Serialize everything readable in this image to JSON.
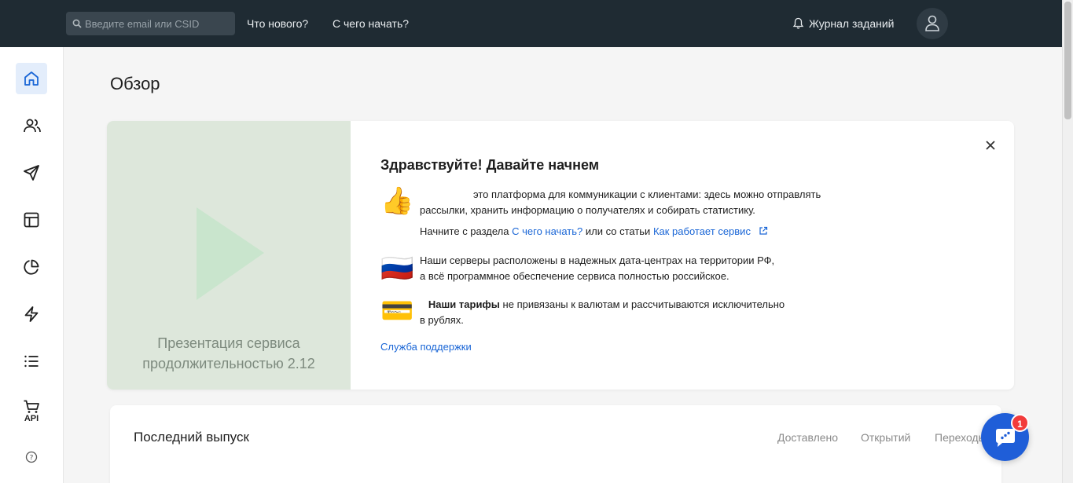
{
  "topbar": {
    "search_placeholder": "Введите email или CSID",
    "links": [
      "Что нового?",
      "С чего начать?"
    ],
    "journal_label": "Журнал заданий",
    "icons": {
      "search": "search-icon",
      "bell": "bell-icon",
      "avatar": "user-icon"
    }
  },
  "sidebar": {
    "items": [
      {
        "icon": "home-icon",
        "active": true
      },
      {
        "icon": "users-icon"
      },
      {
        "icon": "send-icon"
      },
      {
        "icon": "layout-icon"
      },
      {
        "icon": "pie-chart-icon"
      },
      {
        "icon": "zap-icon"
      },
      {
        "icon": "list-icon"
      }
    ],
    "api_label": "API",
    "help_label": "?"
  },
  "main": {
    "page_title": "Обзор",
    "welcome": {
      "video_caption_1": "Презентация сервиса",
      "video_caption_2": "продолжительностью 2.12",
      "title": "Здравствуйте! Давайте начнем",
      "p1_line1": "это платформа для коммуникации с клиентами: здесь можно отправлять",
      "p1_line2": "рассылки, хранить информацию о получателях и собирать статистику.",
      "p2_prefix": "Начните с раздела",
      "p2_link1": "С чего начать?",
      "p2_middle": "или со статьи",
      "p2_link2": "Как работает",
      "p2_link2_suffix": "сервис",
      "p3_line1": "Наши серверы расположены в надежных дата-центрах на территории РФ,",
      "p3_line2": "а всё программное обеспечение сервиса полностью российское.",
      "p4_bold": "Наши тарифы",
      "p4_line1_rest": "не привязаны к валютам и рассчитываются исключительно",
      "p4_line2": "в рублях.",
      "support_link": "Служба поддержки",
      "emojis": {
        "thumb": "👍",
        "flag": "🇷🇺",
        "card": "💳"
      }
    },
    "last_issue": {
      "title": "Последний выпуск",
      "columns": [
        "Доставлено",
        "Открытий",
        "Переходы"
      ]
    }
  },
  "chat": {
    "badge": "1"
  },
  "colors": {
    "topbar": "#1f2b33",
    "accent": "#1a66d6",
    "chat": "#1f5ed8",
    "badge": "#f23b3b",
    "video_bg": "#dde7db"
  }
}
